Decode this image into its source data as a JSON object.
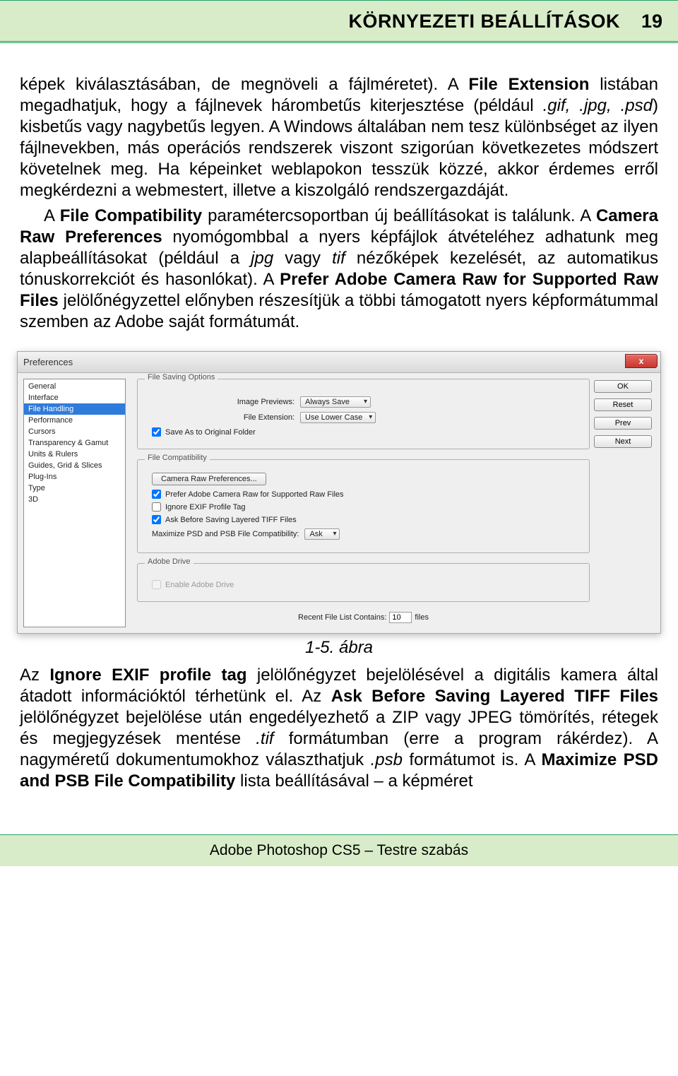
{
  "header": {
    "title": "KÖRNYEZETI BEÁLLÍTÁSOK",
    "page_num": "19"
  },
  "para1_parts": {
    "t1": "képek kiválasztásában, de megnöveli a fájlméretet). A ",
    "b1": "File Extension",
    "t2": " listában megadhatjuk, hogy a fájlnevek hárombetűs kiterjesztése (például ",
    "i1": ".gif, .jpg, .psd",
    "t3": ") kisbetűs vagy nagybetűs legyen. A Windows általában nem tesz különbséget az ilyen fájlnevekben, más operációs rendszerek viszont szigorúan következetes módszert követelnek meg. Ha képeinket weblapokon tesszük közzé, akkor érdemes erről megkérdezni a webmestert, illetve a kiszolgáló rendszergazdáját."
  },
  "para2_parts": {
    "t1": "A ",
    "b1": "File Compatibility",
    "t2": " paramétercsoportban új beállításokat is találunk. A ",
    "b2": "Camera Raw Preferences",
    "t3": " nyomógombbal a nyers képfájlok átvételéhez adhatunk meg alapbeállításokat (például a ",
    "i1": "jpg",
    "t4": " vagy ",
    "i2": "tif",
    "t5": " nézőképek kezelését, az automatikus tónuskorrekciót és hasonlókat). A ",
    "b3": "Prefer Adobe Camera Raw for Supported Raw Files",
    "t6": " jelölőnégyzettel előnyben részesítjük a többi támogatott nyers képformátummal szemben az Adobe saját formátumát."
  },
  "dialog": {
    "title": "Preferences",
    "close": "x",
    "sidebar": [
      "General",
      "Interface",
      "File Handling",
      "Performance",
      "Cursors",
      "Transparency & Gamut",
      "Units & Rulers",
      "Guides, Grid & Slices",
      "Plug-Ins",
      "Type",
      "3D"
    ],
    "selected_index": 2,
    "buttons": {
      "ok": "OK",
      "reset": "Reset",
      "prev": "Prev",
      "next": "Next"
    },
    "group_saving": {
      "title": "File Saving Options",
      "row1_label": "Image Previews:",
      "row1_value": "Always Save",
      "row2_label": "File Extension:",
      "row2_value": "Use Lower Case",
      "chk1": "Save As to Original Folder"
    },
    "group_compat": {
      "title": "File Compatibility",
      "btn": "Camera Raw Preferences...",
      "chk1": "Prefer Adobe Camera Raw for Supported Raw Files",
      "chk2": "Ignore EXIF Profile Tag",
      "chk3": "Ask Before Saving Layered TIFF Files",
      "maxlabel": "Maximize PSD and PSB File Compatibility:",
      "maxvalue": "Ask"
    },
    "group_drive": {
      "title": "Adobe Drive",
      "chk1": "Enable Adobe Drive"
    },
    "recent": {
      "label": "Recent File List Contains:",
      "value": "10",
      "suffix": "files"
    }
  },
  "caption": "1-5. ábra",
  "para3_parts": {
    "t1": "Az ",
    "b1": "Ignore EXIF profile tag",
    "t2": " jelölőnégyzet bejelölésével a digitális kamera által átadott információktól térhetünk el. Az ",
    "b2": "Ask Before Saving Layered TIFF Files",
    "t3": " jelölőnégyzet bejelölése után engedélyezhető a ZIP vagy JPEG tömörítés, rétegek és megjegyzések mentése ",
    "i1": ".tif",
    "t4": " formátumban (erre a program rákérdez). A nagyméretű dokumentumokhoz választhatjuk ",
    "i2": ".psb",
    "t5": " formátumot is. A ",
    "b3": "Maximize PSD and PSB File Compatibility",
    "t6": " lista beállításával – a képméret"
  },
  "footer": "Adobe Photoshop CS5 – Testre szabás"
}
